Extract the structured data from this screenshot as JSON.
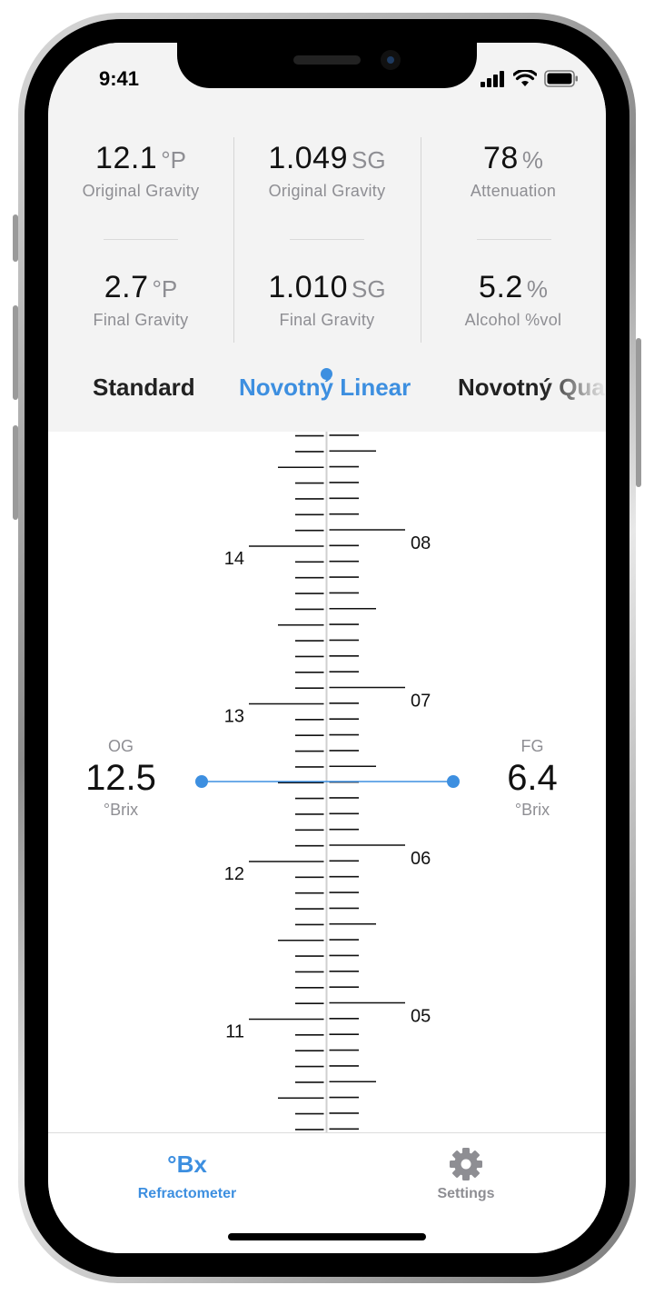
{
  "status_bar": {
    "time": "9:41"
  },
  "stats": {
    "og_plato": {
      "value": "12.1",
      "unit": "°P",
      "label": "Original Gravity"
    },
    "og_sg": {
      "value": "1.049",
      "unit": "SG",
      "label": "Original Gravity"
    },
    "attenuation": {
      "value": "78",
      "unit": "%",
      "label": "Attenuation"
    },
    "fg_plato": {
      "value": "2.7",
      "unit": "°P",
      "label": "Final Gravity"
    },
    "fg_sg": {
      "value": "1.010",
      "unit": "SG",
      "label": "Final Gravity"
    },
    "abv": {
      "value": "5.2",
      "unit": "%",
      "label": "Alcohol %vol"
    }
  },
  "scale_tabs": [
    {
      "label": "Standard",
      "selected": false
    },
    {
      "label": "Novotný Linear",
      "selected": true
    },
    {
      "label": "Novotný Quadratic",
      "selected": false
    }
  ],
  "ruler": {
    "left_labels": [
      "14",
      "13",
      "12",
      "11"
    ],
    "right_labels": [
      "08",
      "07",
      "06",
      "05"
    ]
  },
  "og_reading": {
    "caption": "OG",
    "value": "12.5",
    "unit": "°Brix"
  },
  "fg_reading": {
    "caption": "FG",
    "value": "6.4",
    "unit": "°Brix"
  },
  "tabbar": {
    "refractometer": {
      "icon_text": "°Bx",
      "label": "Refractometer",
      "active": true
    },
    "settings": {
      "label": "Settings",
      "active": false
    }
  },
  "colors": {
    "accent": "#3d8fe0",
    "secondary_text": "#8e8e93",
    "panel_bg": "#f3f3f3"
  }
}
